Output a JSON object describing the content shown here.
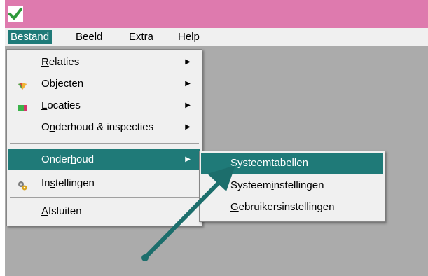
{
  "menubar": {
    "items": [
      {
        "pre": "",
        "u": "B",
        "post": "estand"
      },
      {
        "pre": "Beel",
        "u": "d",
        "post": ""
      },
      {
        "pre": "",
        "u": "E",
        "post": "xtra"
      },
      {
        "pre": "",
        "u": "H",
        "post": "elp"
      }
    ]
  },
  "bestand_menu": {
    "items": [
      {
        "pre": "",
        "u": "R",
        "post": "elaties",
        "icon": "none",
        "submenu": true
      },
      {
        "pre": "",
        "u": "O",
        "post": "bjecten",
        "icon": "objects-icon",
        "submenu": true
      },
      {
        "pre": "",
        "u": "L",
        "post": "ocaties",
        "icon": "locations-icon",
        "submenu": true
      },
      {
        "pre": "O",
        "u": "n",
        "post": "derhoud & inspecties",
        "icon": "none",
        "submenu": true
      },
      {
        "pre": "Onder",
        "u": "h",
        "post": "oud",
        "icon": "none",
        "submenu": true,
        "selected": true
      },
      {
        "pre": "In",
        "u": "s",
        "post": "tellingen",
        "icon": "settings-icon",
        "submenu": false
      },
      {
        "pre": "",
        "u": "A",
        "post": "fsluiten",
        "icon": "none",
        "submenu": false
      }
    ]
  },
  "onderhoud_submenu": {
    "items": [
      {
        "pre": "",
        "u": "S",
        "post": "ysteemtabellen",
        "selected": true
      },
      {
        "pre": "Systeem",
        "u": "i",
        "post": "nstellingen"
      },
      {
        "pre": "",
        "u": "G",
        "post": "ebruikersinstellingen"
      }
    ]
  },
  "colors": {
    "titlebar": "#de7aae",
    "highlight": "#1f7a78",
    "client_bg": "#ababab",
    "menu_bg": "#f0f0f0",
    "annotation_arrow": "#1c6e6c"
  },
  "icons": [
    "app-checkmark-icon",
    "submenu-arrow-icon",
    "objects-icon",
    "locations-icon",
    "settings-icon"
  ]
}
